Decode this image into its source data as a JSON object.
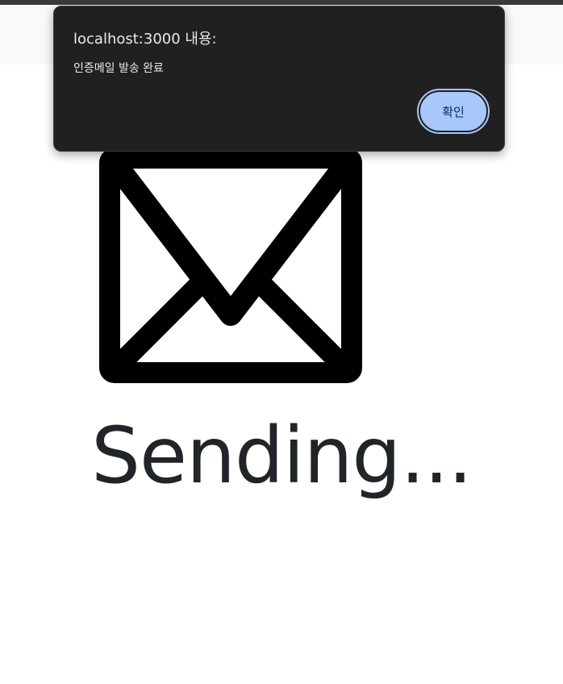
{
  "dialog": {
    "title": "localhost:3000 내용:",
    "message": "인증메일 발송 완료",
    "ok_label": "확인"
  },
  "main": {
    "status_text": "Sending...",
    "icon": "envelope-icon"
  },
  "colors": {
    "dialog_background": "#202020",
    "button_accent": "#a8c7fa",
    "navbar": "#f8f9fa",
    "text": "#212529"
  }
}
